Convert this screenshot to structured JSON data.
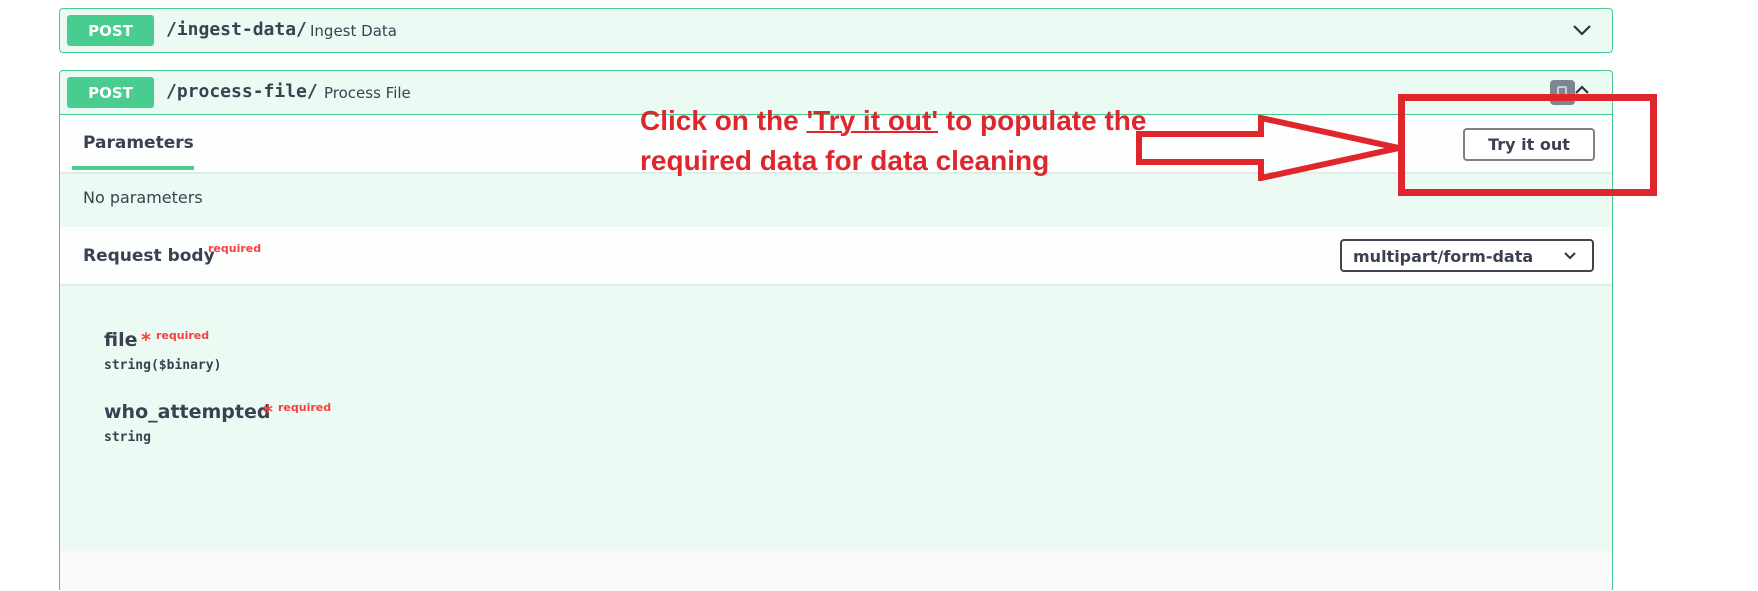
{
  "ingest": {
    "method": "POST",
    "path": "/ingest-data/",
    "summary": "Ingest Data"
  },
  "process": {
    "method": "POST",
    "path": "/process-file/",
    "summary": "Process File",
    "parameters": {
      "tab_label": "Parameters",
      "try_button": "Try it out",
      "empty_text": "No parameters"
    },
    "request_body": {
      "label": "Request body",
      "required_label": "required",
      "content_type": "multipart/form-data",
      "properties": [
        {
          "name": "file",
          "star": "*",
          "required_label": "required",
          "type": "string($binary)"
        },
        {
          "name": "who_attempted",
          "star": "*",
          "required_label": "required",
          "type": "string"
        }
      ]
    }
  },
  "annotation": {
    "text_prefix": "Click on the ",
    "text_highlight": "'Try it out'",
    "text_suffix": " to populate the required data for data cleaning",
    "color": "#e0262d"
  },
  "colors": {
    "post_green": "#49cc90",
    "required_red": "#f93e3e",
    "text": "#3b4151"
  }
}
